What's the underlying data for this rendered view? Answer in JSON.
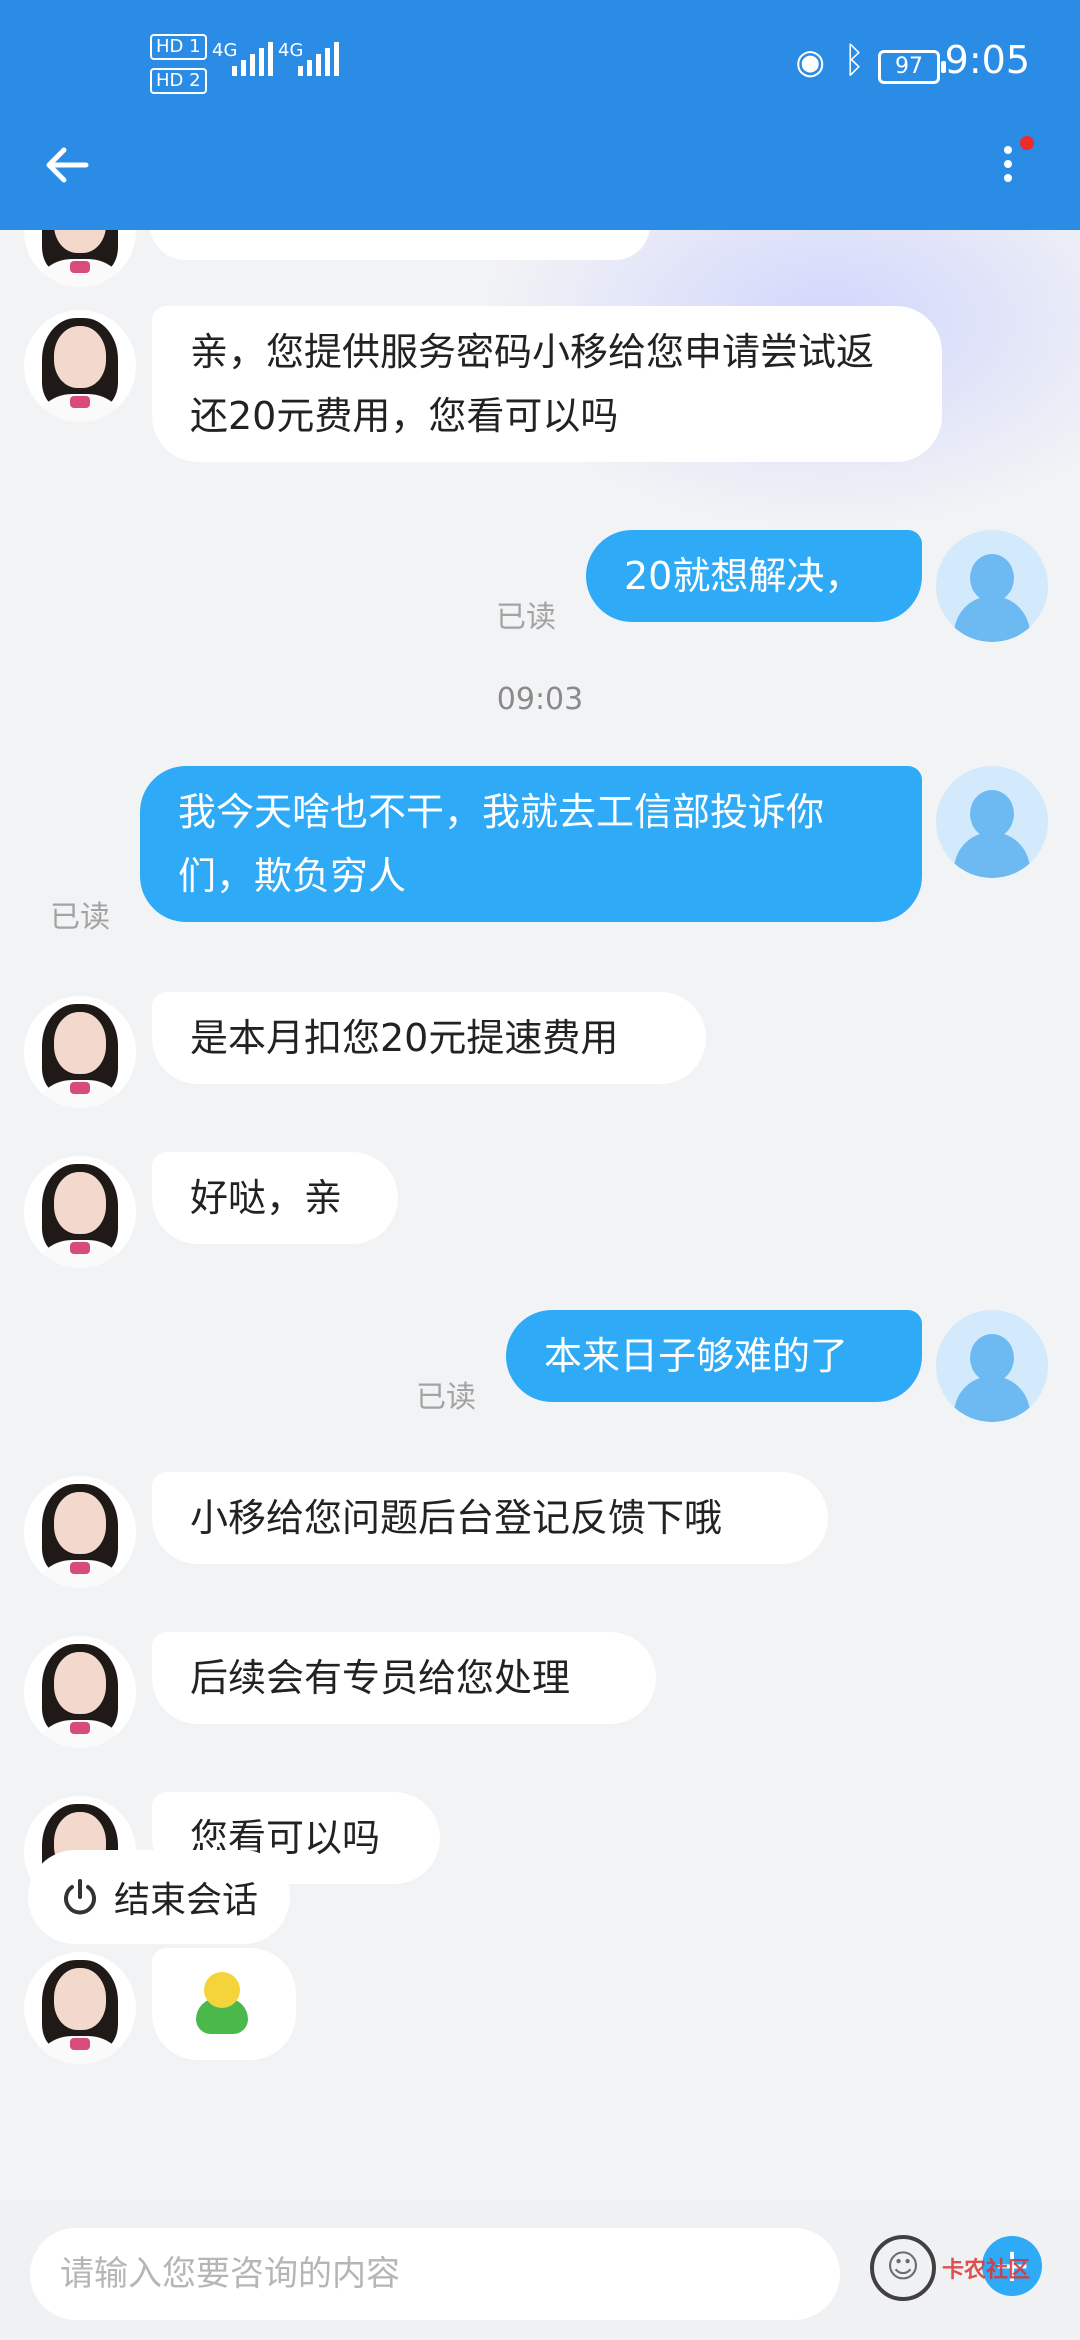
{
  "status_bar": {
    "time": "9:05",
    "battery": "97",
    "sim1_label": "HD 1",
    "sim2_label": "HD 2",
    "network1": "4G",
    "network2": "4G"
  },
  "header": {
    "back_icon": "arrow-left-icon",
    "menu_icon": "more-vertical-icon"
  },
  "messages": [
    {
      "from": "agent",
      "text": "亲，您提供服务密码小移给您申请尝试返还20元费用，您看可以吗"
    },
    {
      "from": "user",
      "text": "20就想解决，",
      "status": "已读"
    },
    {
      "timestamp": "09:03"
    },
    {
      "from": "user",
      "text": "我今天啥也不干，我就去工信部投诉你们，欺负穷人",
      "status": "已读"
    },
    {
      "from": "agent",
      "text": "是本月扣您20元提速费用"
    },
    {
      "from": "agent",
      "text": "好哒，亲"
    },
    {
      "from": "user",
      "text": "本来日子够难的了",
      "status": "已读"
    },
    {
      "from": "agent",
      "text": "小移给您问题后台登记反馈下哦"
    },
    {
      "from": "agent",
      "text": "后续会有专员给您处理"
    },
    {
      "from": "agent",
      "text": "您看可以吗"
    },
    {
      "from": "agent",
      "emoji": "duck-emoji"
    }
  ],
  "end_session": {
    "label": "结束会话",
    "icon": "power-icon"
  },
  "composer": {
    "placeholder": "请输入您要咨询的内容",
    "add_icon": "plus-icon"
  },
  "watermark": {
    "text": "卡农社区"
  },
  "colors": {
    "header": "#2b8ce6",
    "user_bubble": "#2eaaf6",
    "agent_bubble": "#ffffff"
  }
}
